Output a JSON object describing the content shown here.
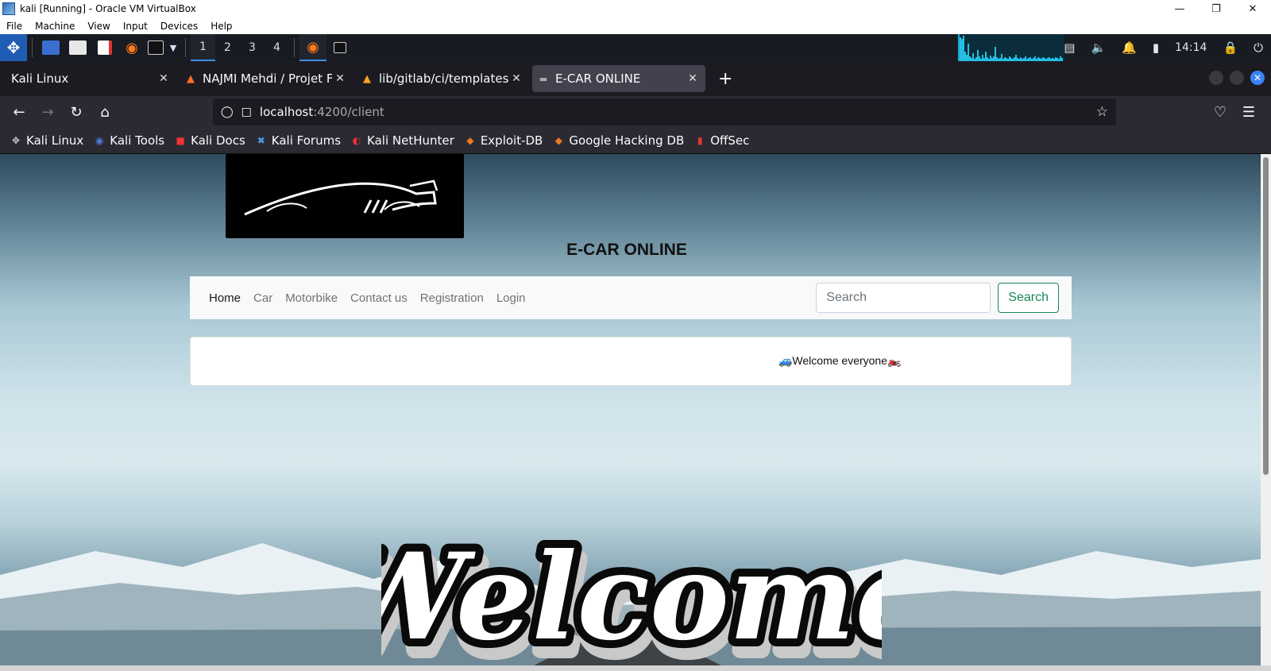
{
  "host": {
    "title": "kali [Running] - Oracle VM VirtualBox",
    "menu": [
      "File",
      "Machine",
      "View",
      "Input",
      "Devices",
      "Help"
    ]
  },
  "panel": {
    "workspaces": [
      "1",
      "2",
      "3",
      "4"
    ],
    "clock": "14:14"
  },
  "browser": {
    "tabs": [
      {
        "title": "Kali Linux",
        "icon": "kali-icon",
        "active": false
      },
      {
        "title": "NAJMI Mehdi / Projet Full",
        "icon": "gitlab-icon",
        "active": false
      },
      {
        "title": "lib/gitlab/ci/templates/Do",
        "icon": "gitlab-icon",
        "active": false
      },
      {
        "title": "E-CAR ONLINE",
        "icon": "car-icon",
        "active": true
      }
    ],
    "url_host": "localhost",
    "url_path": ":4200/client",
    "bookmarks": [
      "Kali Linux",
      "Kali Tools",
      "Kali Docs",
      "Kali Forums",
      "Kali NetHunter",
      "Exploit-DB",
      "Google Hacking DB",
      "OffSec"
    ]
  },
  "page": {
    "site_title": "E-CAR ONLINE",
    "nav": [
      "Home",
      "Car",
      "Motorbike",
      "Contact us",
      "Registration",
      "Login"
    ],
    "search_placeholder": "Search",
    "search_button": "Search",
    "marquee_text": "🚙Welcome everyone🏍️",
    "hero_text": "Welcome"
  },
  "colors": {
    "panel_bg": "#181b21",
    "firefox_tabstrip": "#1c1b22",
    "firefox_toolbar": "#2b2a33",
    "search_button": "#198754",
    "kali_blue": "#1f5db4"
  }
}
